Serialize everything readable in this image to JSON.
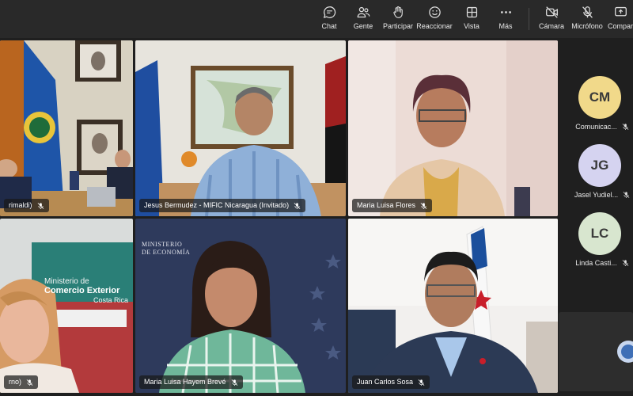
{
  "toolbar": {
    "chat": "Chat",
    "people": "Gente",
    "raise": "Participar",
    "react": "Reaccionar",
    "view": "Vista",
    "more": "Más",
    "camera": "Cámara",
    "mic": "Micrófono",
    "share": "Compar"
  },
  "tiles": [
    {
      "name": "rimaldi)"
    },
    {
      "name": "Jesus Bermudez - MIFIC Nicaragua (Invitado)"
    },
    {
      "name": "Maria Luisa Flores"
    },
    {
      "name": "rno)",
      "logo_line1": "Ministerio de",
      "logo_line2": "Comercio Exterior",
      "logo_line3": "Costa Rica"
    },
    {
      "name": "Maria Luisa Hayem Brevé",
      "logo_line1": "MINISTERIO",
      "logo_line2": "DE ECONOMÍA"
    },
    {
      "name": "Juan Carlos Sosa"
    }
  ],
  "participants": [
    {
      "initials": "CM",
      "name": "Comunicac...",
      "color": "#f1d98a"
    },
    {
      "initials": "JG",
      "name": "Jasel Yudiel...",
      "color": "#d5d3f0"
    },
    {
      "initials": "LC",
      "name": "Linda Casti...",
      "color": "#d8e6cf"
    }
  ]
}
